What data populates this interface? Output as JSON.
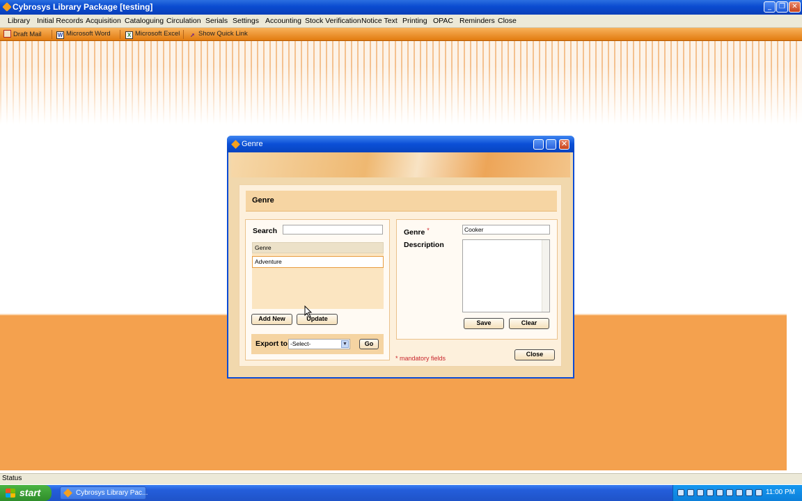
{
  "window": {
    "title": "Cybrosys Library Package [testing]"
  },
  "menu": [
    "Library",
    "Initial Records",
    "Acquisition",
    "Cataloguing",
    "Circulation",
    "Serials",
    "Settings",
    "Accounting",
    "Stock Verification",
    "Notice Text",
    "Printing",
    "OPAC",
    "Reminders",
    "Close"
  ],
  "quickbar": {
    "items": [
      "Draft Mail",
      "Microsoft Word",
      "Microsoft Excel",
      "Show Quick Link"
    ]
  },
  "status": {
    "text": "Status"
  },
  "taskbar": {
    "start": "start",
    "task": "Cybrosys Library Pac...",
    "clock": "11:00 PM"
  },
  "dialog": {
    "title": "Genre",
    "header": "Genre",
    "search_label": "Search",
    "search_value": "",
    "list": {
      "column": "Genre",
      "rows": [
        "Adventure"
      ]
    },
    "add_new": "Add New",
    "update": "Update",
    "export_label": "Export to",
    "export_select": "-Select-",
    "go": "Go",
    "genre_label": "Genre",
    "required_mark": "*",
    "genre_value": "Cooker",
    "description_label": "Description",
    "description_value": "",
    "save": "Save",
    "clear": "Clear",
    "mandatory_note": "* mandatory fields",
    "close": "Close"
  },
  "colors": {
    "accent": "#f4a14e",
    "titlebar": "#0a4bd0",
    "required": "#d2232a"
  }
}
